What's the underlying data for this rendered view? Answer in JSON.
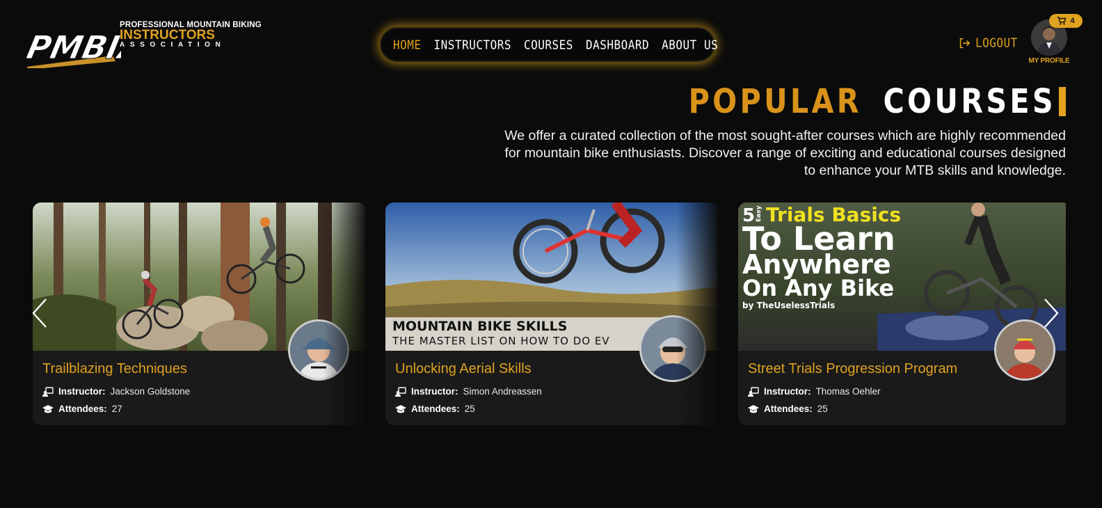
{
  "brand": {
    "logo_mark": "PMBIA",
    "line1": "PROFESSIONAL MOUNTAIN BIKING",
    "line2": "INSTRUCTORS",
    "line3": "ASSOCIATION"
  },
  "nav": {
    "items": [
      {
        "label": "HOME",
        "active": true
      },
      {
        "label": "INSTRUCTORS",
        "active": false
      },
      {
        "label": "COURSES",
        "active": false
      },
      {
        "label": "DASHBOARD",
        "active": false
      },
      {
        "label": "ABOUT US",
        "active": false
      }
    ]
  },
  "header": {
    "logout_label": "LOGOUT",
    "logout_icon": "logout-icon",
    "profile_label": "MY PROFILE",
    "cart_count": "4",
    "cart_icon": "cart-icon"
  },
  "section": {
    "title_word1": "POPULAR",
    "title_word2": "COURSES",
    "description": "We offer a curated collection of the most sought-after courses which are highly recommended for mountain bike enthusiasts. Discover a range of exciting and educational courses designed to enhance your MTB skills and knowledge."
  },
  "courses": [
    {
      "title": "Trailblazing Techniques",
      "instructor_label": "Instructor:",
      "instructor": "Jackson Goldstone",
      "attendees_label": "Attendees:",
      "attendees": "27"
    },
    {
      "title": "Unlocking Aerial Skills",
      "instructor_label": "Instructor:",
      "instructor": "Simon Andreassen",
      "attendees_label": "Attendees:",
      "attendees": "25",
      "image_text": {
        "line1": "MOUNTAIN BIKE SKILLS",
        "line2": "THE MASTER LIST ON HOW TO DO EV"
      }
    },
    {
      "title": "Street Trials Progression Program",
      "instructor_label": "Instructor:",
      "instructor": "Thomas Oehler",
      "attendees_label": "Attendees:",
      "attendees": "25",
      "image_text": {
        "num": "5",
        "easy": "Easy",
        "top": "Trials Basics",
        "l1": "To Learn",
        "l2": "Anywhere",
        "l3": "On Any Bike",
        "by": "by TheUselessTrials"
      }
    }
  ],
  "colors": {
    "accent": "#e0a21f",
    "background": "#0b0b0b",
    "card": "#1a1a1a"
  }
}
